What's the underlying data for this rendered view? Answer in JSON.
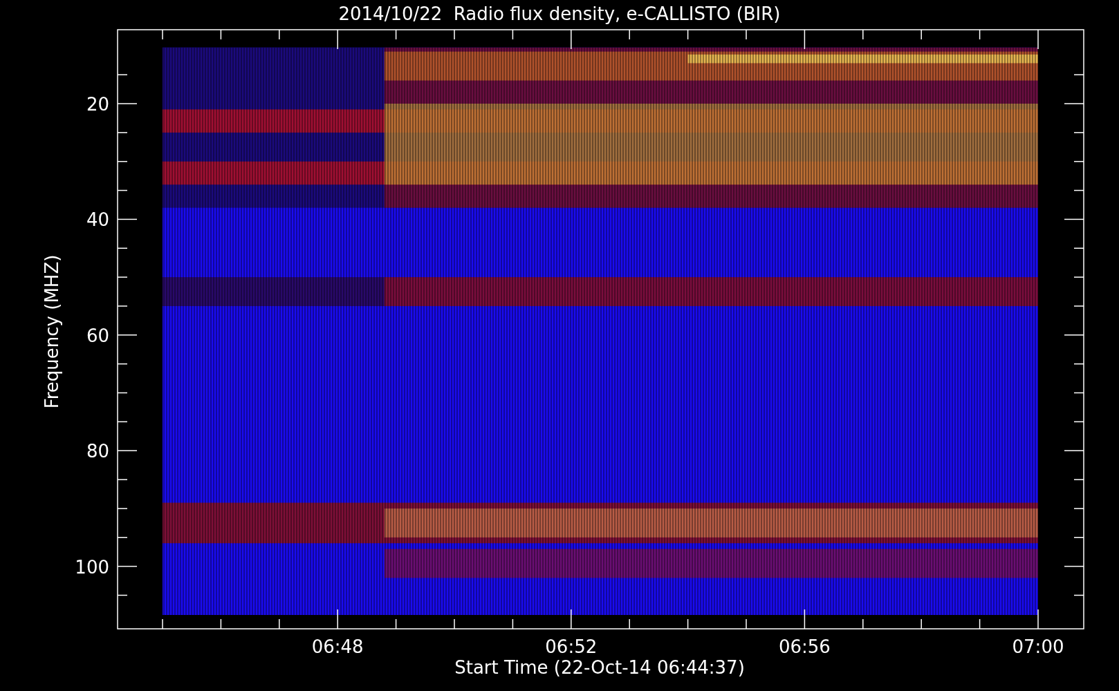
{
  "title": "2014/10/22  Radio flux density, e-CALLISTO (BIR)",
  "plot": {
    "ylabel": "Frequency (MHZ)",
    "xlabel": "Start Time (22-Oct-14 06:44:37)",
    "y_tick_labels": [
      "20",
      "40",
      "60",
      "80",
      "100"
    ],
    "x_tick_labels": [
      "06:48",
      "06:52",
      "06:56",
      "07:00"
    ]
  }
}
